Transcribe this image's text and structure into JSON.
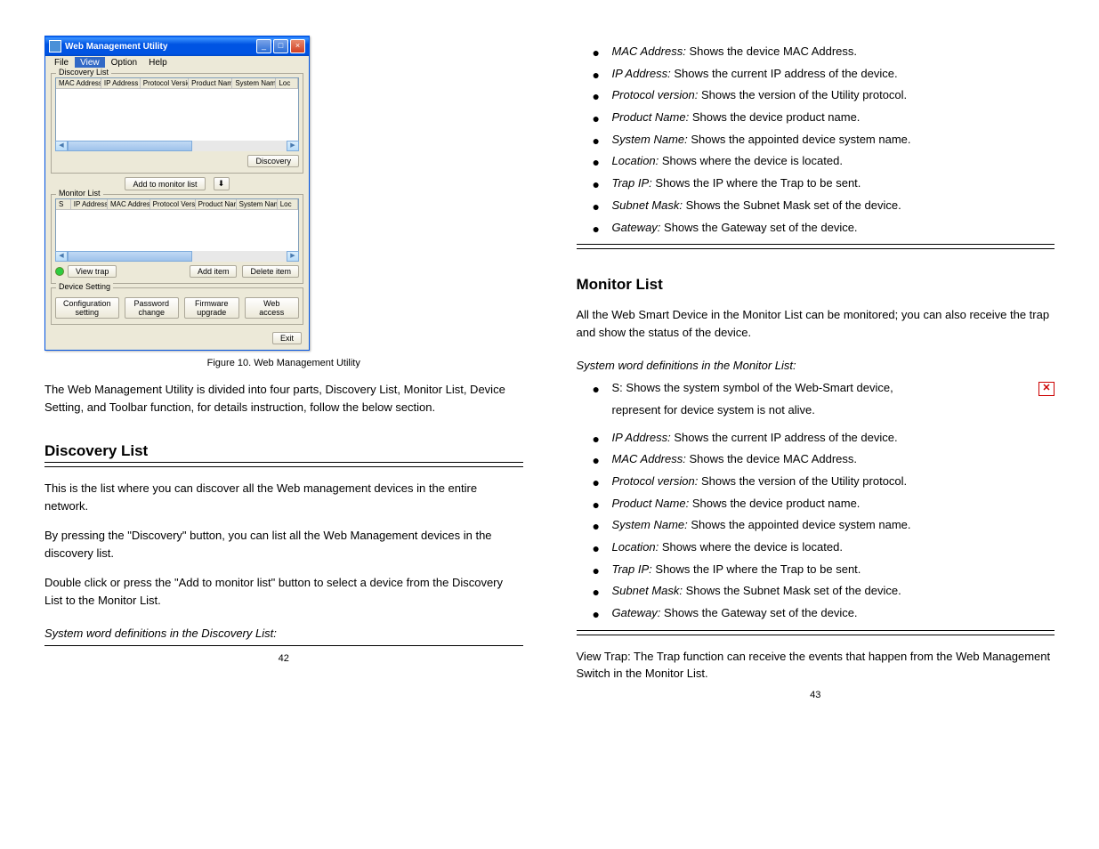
{
  "app_window": {
    "title": "Web Management Utility",
    "menu": {
      "file": "File",
      "view": "View",
      "option": "Option",
      "help": "Help"
    },
    "discovery_group": "Discovery List",
    "discovery_cols": {
      "mac": "MAC Address",
      "ip": "IP Address",
      "proto": "Protocol Version",
      "product": "Product Name",
      "system": "System Name",
      "loc": "Loc"
    },
    "discovery_btn": "Discovery",
    "add_monitor_btn": "Add to monitor list",
    "monitor_group": "Monitor List",
    "monitor_cols": {
      "s": "S",
      "ip": "IP Address",
      "mac": "MAC Address",
      "proto": "Protocol Version",
      "product": "Product Name",
      "system": "System Name",
      "loc": "Loc"
    },
    "view_trap_btn": "View trap",
    "add_item_btn": "Add item",
    "delete_item_btn": "Delete item",
    "device_setting_group": "Device Setting",
    "config_btn": "Configuration setting",
    "password_btn": "Password change",
    "firmware_btn": "Firmware upgrade",
    "web_access_btn": "Web access",
    "exit_btn": "Exit"
  },
  "left": {
    "figure_label": "Figure 10. Web Management Utility",
    "body1": "The Web Management Utility is divided into four parts, Discovery List, Monitor List, Device Setting, and Toolbar function, for details instruction, follow the below section.",
    "discovery_title": "Discovery List",
    "body2": "This is the list where you can discover all the Web management devices in the entire network.",
    "body3": "By pressing the \"Discovery\" button, you can list all the Web Management devices in the discovery list.",
    "body4": "Double click or press the \"Add to monitor list\" button to select a device from the Discovery List to the Monitor List.",
    "system_word_heading": "System word definitions in the Discovery List:",
    "page_num": "42"
  },
  "right": {
    "bullets1": [
      "MAC Address: Shows the device MAC Address.",
      "IP Address: Shows the current IP address of the device.",
      "Protocol version: Shows the version of the Utility protocol.",
      "Product Name: Shows the device product name.",
      "System Name: Shows the appointed device system name.",
      "Location: Shows where the device is located.",
      "Trap IP: Shows the IP where the Trap to be sent.",
      "Subnet Mask: Shows the Subnet Mask set of the device.",
      "Gateway: Shows the Gateway set of the device."
    ],
    "monitor_title": "Monitor List",
    "body5": "All the Web Smart Device in the Monitor List can be monitored; you can also receive the trap and show the status of the device.",
    "system_word_heading2": "System word definitions in the Monitor List:",
    "bullet_s_prefix": "S: Shows the system symbol of the Web-Smart device,",
    "bullet_s_suffix": " represent for device system is not alive.",
    "bullets2": [
      "IP Address: Shows the current IP address of the device.",
      "MAC Address: Shows the device MAC Address.",
      "Protocol version: Shows the version of the Utility protocol.",
      "Product Name: Shows the device product name.",
      "System Name: Shows the appointed device system name.",
      "Location: Shows where the device is located.",
      "Trap IP: Shows the IP where the Trap to be sent.",
      "Subnet Mask: Shows the Subnet Mask set of the device.",
      "Gateway: Shows the Gateway set of the device."
    ],
    "view_trap_body": "View Trap: The Trap function can receive the events that happen from the Web Management Switch in the Monitor List.",
    "page_num": "43"
  }
}
